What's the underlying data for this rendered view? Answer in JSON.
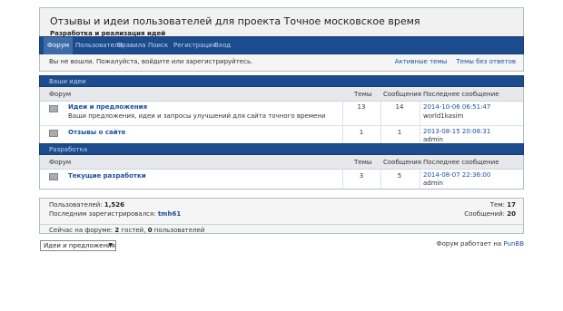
{
  "header": {
    "title": "Отзывы и идеи пользователей для проекта Точное московское время",
    "description": "Разработка и реализация идей"
  },
  "nav": {
    "items": [
      "Форум",
      "Пользователи",
      "Правила",
      "Поиск",
      "Регистрация",
      "Вход"
    ],
    "active_index": 0
  },
  "status": {
    "message": "Вы не вошли. Пожалуйста, войдите или зарегистрируйтесь.",
    "links": [
      "Активные темы",
      "Темы без ответов"
    ]
  },
  "columns": {
    "forum": "Форум",
    "topics": "Темы",
    "posts": "Сообщения",
    "last_post": "Последнее сообщение"
  },
  "categories": [
    {
      "name": "Ваши идеи",
      "forums": [
        {
          "name": "Идеи и предложения",
          "description": "Ваши предложения, идеи и запросы улучшений для сайта точного времени",
          "topics": "13",
          "posts": "14",
          "last_date": "2014-10-06 06:51:47",
          "last_user": "world1kasim"
        },
        {
          "name": "Отзывы о сайте",
          "description": "",
          "topics": "1",
          "posts": "1",
          "last_date": "2013-08-15 20:08:31",
          "last_user": "admin"
        }
      ]
    },
    {
      "name": "Разработка",
      "forums": [
        {
          "name": "Текущие разработки",
          "description": "",
          "topics": "3",
          "posts": "5",
          "last_date": "2014-08-07 22:36:00",
          "last_user": "admin"
        }
      ]
    }
  ],
  "stats": {
    "users_label": "Пользователей:",
    "users_value": "1,526",
    "last_reg_label": "Последним зарегистрировался:",
    "last_reg_user": "tmh61",
    "topics_label": "Тем:",
    "topics_value": "17",
    "posts_label": "Сообщений:",
    "posts_value": "20",
    "online_prefix": "Сейчас на форуме:",
    "online_guests": "2",
    "online_guests_label": "гостей,",
    "online_users": "0",
    "online_users_label": "пользователей"
  },
  "footer": {
    "jump_selected": "Идеи и предложения",
    "powered_text": "Форум работает на",
    "powered_link": "PunBB"
  }
}
